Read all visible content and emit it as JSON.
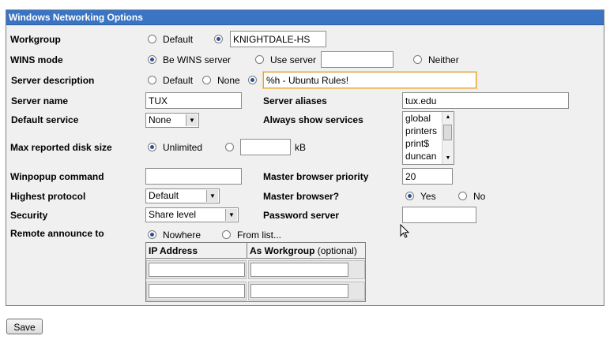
{
  "header": {
    "title": "Windows Networking Options"
  },
  "workgroup": {
    "label": "Workgroup",
    "opt_default": "Default",
    "value": "KNIGHTDALE-HS"
  },
  "wins": {
    "label": "WINS mode",
    "opt_be": "Be WINS server",
    "opt_use": "Use server",
    "use_value": "",
    "opt_neither": "Neither"
  },
  "server_desc": {
    "label": "Server description",
    "opt_default": "Default",
    "opt_none": "None",
    "value": "%h - Ubuntu Rules!"
  },
  "server_name": {
    "label": "Server name",
    "value": "TUX"
  },
  "server_aliases": {
    "label": "Server aliases",
    "value": "tux.edu"
  },
  "default_service": {
    "label": "Default service",
    "selected": "None"
  },
  "always_show": {
    "label": "Always show services",
    "options": [
      "global",
      "printers",
      "print$",
      "duncan"
    ]
  },
  "max_disk": {
    "label": "Max reported disk size",
    "opt_unlimited": "Unlimited",
    "value": "",
    "unit": "kB"
  },
  "winpopup": {
    "label": "Winpopup command",
    "value": ""
  },
  "master_priority": {
    "label": "Master browser priority",
    "value": "20"
  },
  "highest_protocol": {
    "label": "Highest protocol",
    "selected": "Default"
  },
  "master_browser": {
    "label": "Master browser?",
    "opt_yes": "Yes",
    "opt_no": "No"
  },
  "security": {
    "label": "Security",
    "selected": "Share level"
  },
  "password_server": {
    "label": "Password server",
    "value": ""
  },
  "remote_announce": {
    "label": "Remote announce to",
    "opt_nowhere": "Nowhere",
    "opt_fromlist": "From list...",
    "col_ip": "IP Address",
    "col_wg": "As Workgroup",
    "col_wg_note": "(optional)"
  },
  "save": {
    "label": "Save"
  },
  "colors": {
    "header_bg": "#3a74c2",
    "panel_bg": "#f0f0f0",
    "focus_border": "#e2a23a"
  }
}
